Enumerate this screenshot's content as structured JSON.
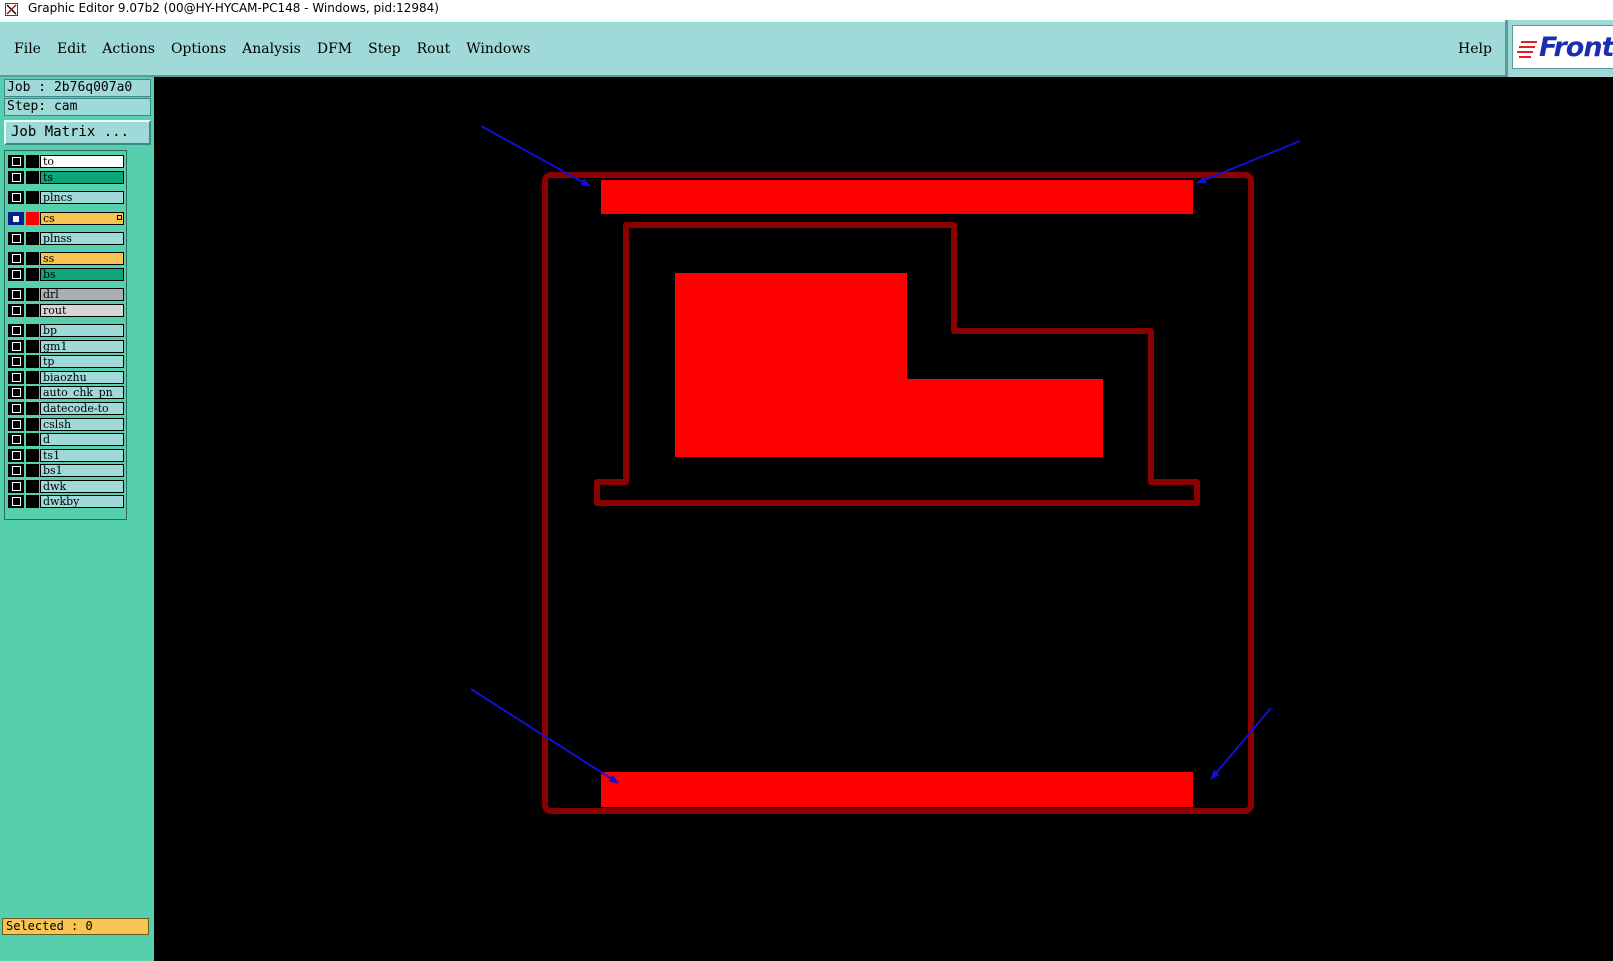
{
  "window": {
    "title": "Graphic Editor 9.07b2 (00@HY-HYCAM-PC148 - Windows, pid:12984)"
  },
  "menu": {
    "items": [
      "File",
      "Edit",
      "Actions",
      "Options",
      "Analysis",
      "DFM",
      "Step",
      "Rout",
      "Windows"
    ],
    "help": "Help"
  },
  "logo": {
    "text": "Front"
  },
  "panel": {
    "job": "Job : 2b76q007a0",
    "step": "Step: cam",
    "job_matrix": "Job Matrix ..."
  },
  "layers": [
    {
      "name": "to",
      "color": "#ffffff",
      "swatch": "none"
    },
    {
      "name": "ts",
      "color": "#0ea57a",
      "swatch": "none"
    },
    {
      "name": "plncs",
      "color": "#9fd9d8",
      "swatch": "none"
    },
    {
      "name": "cs",
      "color": "#f9c552",
      "swatch": "red",
      "active": true
    },
    {
      "name": "plnss",
      "color": "#9fd9d8",
      "swatch": "none"
    },
    {
      "name": "ss",
      "color": "#f9c552",
      "swatch": "none"
    },
    {
      "name": "bs",
      "color": "#0ea57a",
      "swatch": "none"
    },
    {
      "name": "drl",
      "color": "#a9b0b4",
      "swatch": "none"
    },
    {
      "name": "rout",
      "color": "#d6d6d6",
      "swatch": "none"
    },
    {
      "name": "bp",
      "color": "#9fd9d8",
      "swatch": "none"
    },
    {
      "name": "gm1",
      "color": "#9fd9d8",
      "swatch": "none"
    },
    {
      "name": "tp",
      "color": "#9fd9d8",
      "swatch": "none"
    },
    {
      "name": "biaozhu",
      "color": "#9fd9d8",
      "swatch": "none"
    },
    {
      "name": "auto_chk_pn",
      "color": "#9fd9d8",
      "swatch": "none"
    },
    {
      "name": "datecode-to",
      "color": "#9fd9d8",
      "swatch": "none"
    },
    {
      "name": "cslsh",
      "color": "#9fd9d8",
      "swatch": "none"
    },
    {
      "name": "d",
      "color": "#9fd9d8",
      "swatch": "none"
    },
    {
      "name": "ts1",
      "color": "#9fd9d8",
      "swatch": "none"
    },
    {
      "name": "bs1",
      "color": "#9fd9d8",
      "swatch": "none"
    },
    {
      "name": "dwk",
      "color": "#9fd9d8",
      "swatch": "none"
    },
    {
      "name": "dwkby",
      "color": "#9fd9d8",
      "swatch": "none"
    }
  ],
  "status": {
    "selected": "Selected : 0"
  },
  "colors": {
    "menu_bg": "#9fd9d8",
    "panel_bg": "#56cfad",
    "copper": "#ff0000",
    "outline": "#8b0000",
    "arrow": "#1010d0"
  },
  "icons": [
    "app-icon",
    "arrow-icon"
  ]
}
